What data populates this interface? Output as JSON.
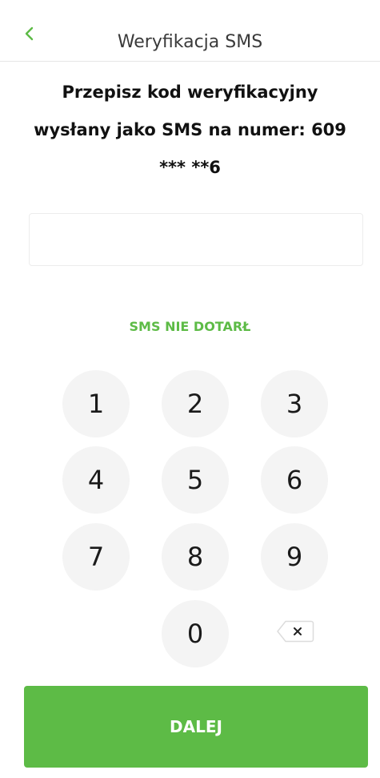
{
  "header": {
    "title": "Weryfikacja SMS",
    "back_icon": "chevron-left-icon"
  },
  "instruction": {
    "line1": "Przepisz kod weryfikacyjny",
    "line2": "wysłany jako SMS na numer: 609",
    "line3": "*** **6"
  },
  "code_input": {
    "value": "",
    "placeholder": ""
  },
  "sms_not_received": "SMS NIE DOTARŁ",
  "keypad": {
    "keys": [
      "1",
      "2",
      "3",
      "4",
      "5",
      "6",
      "7",
      "8",
      "9",
      "0"
    ],
    "backspace_icon": "backspace-icon"
  },
  "next_button": "DALEJ",
  "colors": {
    "accent": "#5dbb46",
    "key_background": "#f4f4f4"
  }
}
